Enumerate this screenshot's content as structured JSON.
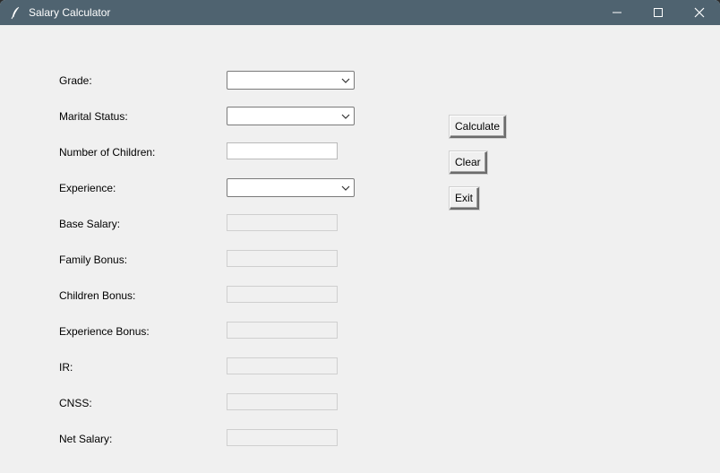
{
  "window": {
    "title": "Salary Calculator",
    "titlebar_color": "#4f6370",
    "background_color": "#f0f0f0"
  },
  "titlebar_controls": [
    "minimize-icon",
    "maximize-icon",
    "close-icon"
  ],
  "form": {
    "grade": {
      "label": "Grade:",
      "value": ""
    },
    "marital_status": {
      "label": "Marital Status:",
      "value": ""
    },
    "number_of_children": {
      "label": "Number of Children:",
      "value": ""
    },
    "experience": {
      "label": "Experience:",
      "value": ""
    },
    "base_salary": {
      "label": "Base Salary:",
      "value": ""
    },
    "family_bonus": {
      "label": "Family Bonus:",
      "value": ""
    },
    "children_bonus": {
      "label": "Children Bonus:",
      "value": ""
    },
    "experience_bonus": {
      "label": "Experience Bonus:",
      "value": ""
    },
    "ir": {
      "label": "IR:",
      "value": ""
    },
    "cnss": {
      "label": "CNSS:",
      "value": ""
    },
    "net_salary": {
      "label": "Net Salary:",
      "value": ""
    }
  },
  "buttons": {
    "calculate": "Calculate",
    "clear": "Clear",
    "exit": "Exit"
  }
}
